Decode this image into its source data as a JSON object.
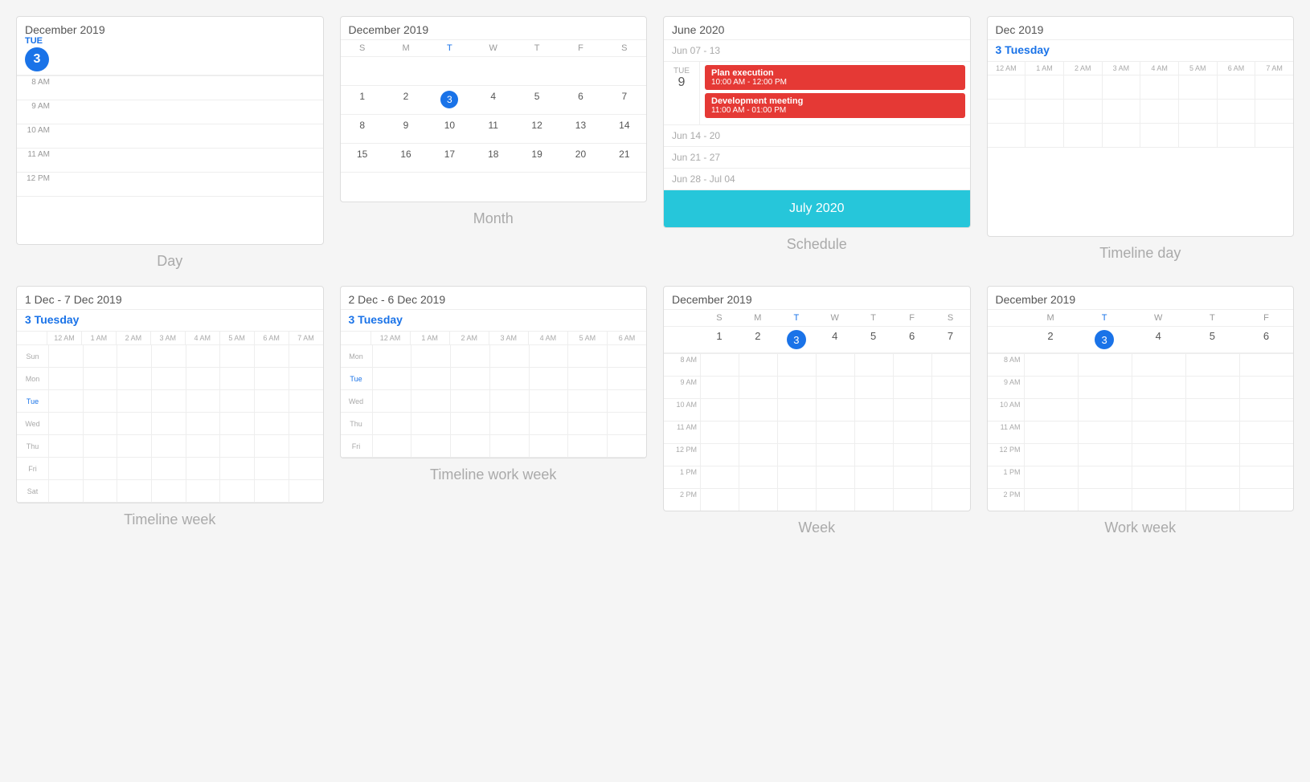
{
  "day": {
    "title": "December 2019",
    "dayLabel": "TUE",
    "dayNum": "3",
    "label": "Day",
    "times": [
      "8 AM",
      "9 AM",
      "10 AM",
      "11 AM",
      "12 PM"
    ]
  },
  "month": {
    "title": "December 2019",
    "label": "Month",
    "dows": [
      "S",
      "M",
      "T",
      "W",
      "T",
      "F",
      "S"
    ],
    "todayDow": 2,
    "weeks": [
      [
        null,
        null,
        null,
        null,
        null,
        null,
        null
      ],
      [
        1,
        2,
        3,
        4,
        5,
        6,
        7
      ],
      [
        8,
        9,
        10,
        11,
        12,
        13,
        14
      ],
      [
        15,
        16,
        17,
        18,
        19,
        20,
        21
      ],
      [
        null,
        null,
        null,
        null,
        null,
        null,
        null
      ]
    ],
    "todayNum": 3
  },
  "schedule": {
    "title": "June 2020",
    "label": "Schedule",
    "weeks": [
      {
        "label": "Jun 07 - 13",
        "events": []
      },
      {
        "label": "",
        "dayName": "TUE",
        "dayNum": "9",
        "events": [
          {
            "title": "Plan execution",
            "time": "10:00 AM - 12:00 PM"
          },
          {
            "title": "Development meeting",
            "time": "11:00 AM - 01:00 PM"
          }
        ]
      },
      {
        "label": "Jun 14 - 20",
        "events": []
      },
      {
        "label": "Jun 21 - 27",
        "events": []
      },
      {
        "label": "Jun 28 - Jul 04",
        "events": []
      }
    ],
    "julyBanner": "July 2020"
  },
  "timelineDay": {
    "title": "Dec 2019",
    "dayLabel": "3 Tuesday",
    "label": "Timeline day",
    "timeLabels": [
      "12 AM",
      "1 AM",
      "2 AM",
      "3 AM",
      "4 AM",
      "5 AM",
      "6 AM",
      "7 AM"
    ]
  },
  "timelineWeek": {
    "title": "1 Dec - 7 Dec 2019",
    "dayLabel": "3 Tuesday",
    "label": "Timeline week",
    "timeLabels": [
      "12 AM",
      "1 AM",
      "2 AM",
      "3 AM",
      "4 AM",
      "5 AM",
      "6 AM",
      "7 AM"
    ],
    "dayLabels": [
      "Sun",
      "Mon",
      "Tue",
      "Wed",
      "Thu",
      "Fri",
      "Sat"
    ]
  },
  "timelineWorkWeek": {
    "title": "2 Dec - 6 Dec 2019",
    "dayLabel": "3 Tuesday",
    "label": "Timeline work week",
    "timeLabels": [
      "12 AM",
      "1 AM",
      "2 AM",
      "3 AM",
      "4 AM",
      "5 AM",
      "6 AM"
    ]
  },
  "week": {
    "title": "December 2019",
    "label": "Week",
    "dows": [
      "S",
      "M",
      "T",
      "W",
      "T",
      "F",
      "S"
    ],
    "dates": [
      1,
      2,
      3,
      4,
      5,
      6,
      7
    ],
    "todayIdx": 2,
    "times": [
      "8 AM",
      "9 AM",
      "10 AM",
      "11 AM",
      "12 PM",
      "1 PM",
      "2 PM"
    ]
  },
  "workWeek": {
    "title": "December 2019",
    "label": "Work week",
    "dows": [
      "M",
      "T",
      "W",
      "T",
      "F"
    ],
    "dates": [
      2,
      3,
      4,
      5,
      6
    ],
    "todayIdx": 1,
    "times": [
      "8 AM",
      "9 AM",
      "10 AM",
      "11 AM",
      "12 PM",
      "1 PM",
      "2 PM"
    ]
  },
  "colors": {
    "blue": "#1a73e8",
    "red": "#e53935",
    "teal": "#26c6da",
    "gray": "#aaaaaa"
  }
}
